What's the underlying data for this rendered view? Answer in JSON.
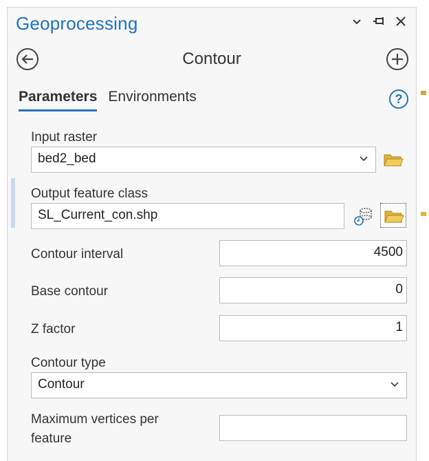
{
  "pane": {
    "title": "Geoprocessing",
    "tool_name": "Contour",
    "tabs": [
      "Parameters",
      "Environments"
    ]
  },
  "params": {
    "input_raster_label": "Input raster",
    "input_raster_value": "bed2_bed",
    "output_label": "Output feature class",
    "output_value": "SL_Current_con.shp",
    "contour_interval_label": "Contour interval",
    "contour_interval_value": "4500",
    "base_contour_label": "Base contour",
    "base_contour_value": "0",
    "z_factor_label": "Z factor",
    "z_factor_value": "1",
    "contour_type_label": "Contour type",
    "contour_type_value": "Contour",
    "max_vertices_label_1": "Maximum vertices per",
    "max_vertices_label_2": "feature",
    "max_vertices_value": ""
  },
  "colors": {
    "accent": "#1e73be",
    "folder": "#e0b43a",
    "pane_bg": "#f7f7f7"
  }
}
